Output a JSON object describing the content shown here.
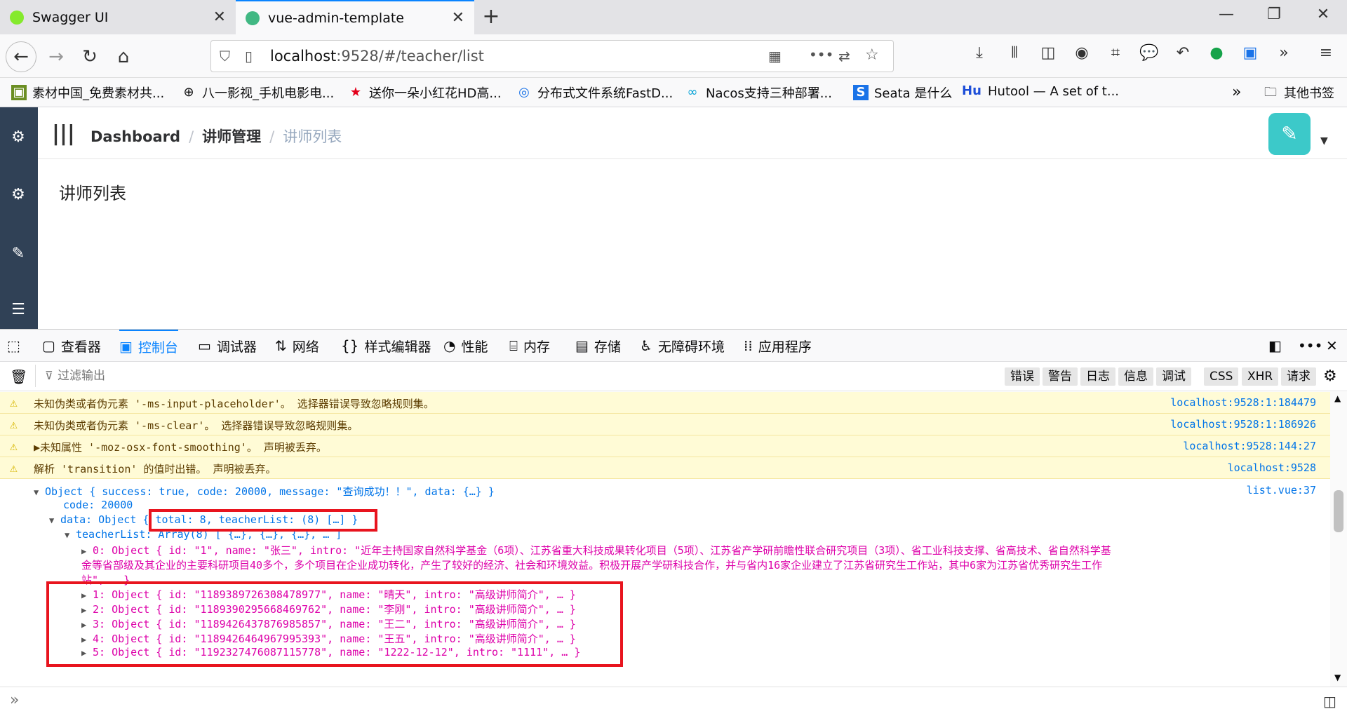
{
  "browser": {
    "tabs": [
      {
        "title": "Swagger UI",
        "color": "#85ea2d"
      },
      {
        "title": "vue-admin-template",
        "color": "#41b883"
      }
    ],
    "url_host": "localhost",
    "url_rest": ":9528/#/teacher/list"
  },
  "bookmarks": [
    {
      "icon": "image-icon",
      "label": "素材中国_免费素材共..."
    },
    {
      "icon": "globe-icon",
      "label": "八一影视_手机电影电..."
    },
    {
      "icon": "star-icon",
      "label": "送你一朵小红花HD高..."
    },
    {
      "icon": "fastdfs-icon",
      "label": "分布式文件系统FastD..."
    },
    {
      "icon": "nacos-icon",
      "label": "Nacos支持三种部署..."
    },
    {
      "icon": "seata-icon",
      "label": "Seata 是什么"
    },
    {
      "icon": "hutool-icon",
      "label": "Hutool — A set of t..."
    }
  ],
  "bookmarks_other": "其他书签",
  "app": {
    "breadcrumb": [
      "Dashboard",
      "讲师管理",
      "讲师列表"
    ],
    "page_title": "讲师列表"
  },
  "devtools": {
    "tabs": [
      "查看器",
      "控制台",
      "调试器",
      "网络",
      "样式编辑器",
      "性能",
      "内存",
      "存储",
      "无障碍环境",
      "应用程序"
    ],
    "active_tab": "控制台",
    "filter_placeholder": "过滤输出",
    "filters": [
      "错误",
      "警告",
      "日志",
      "信息",
      "调试",
      "CSS",
      "XHR",
      "请求"
    ],
    "warnings": [
      {
        "text": "未知伪类或者伪元素 '-ms-input-placeholder'。  选择器错误导致忽略规则集。",
        "loc": "localhost:9528:1:184479"
      },
      {
        "text": "未知伪类或者伪元素 '-ms-clear'。  选择器错误导致忽略规则集。",
        "loc": "localhost:9528:1:186926"
      },
      {
        "text": "▶未知属性 '-moz-osx-font-smoothing'。  声明被丢弃。",
        "loc": "localhost:9528:144:27"
      },
      {
        "text": "解析 'transition' 的值时出错。  声明被丢弃。",
        "loc": "localhost:9528"
      }
    ],
    "log_loc": "list.vue:37",
    "log": {
      "root": "Object { success: true, code: 20000, message: \"查询成功！！\", data: {…} }",
      "code": "code: 20000",
      "data_label": "data: Object ",
      "data_summary": "{ total: 8, teacherList: (8) […] }",
      "teacherList": "teacherList: Array(8) [ {…}, {…}, {…}, … ]",
      "item0_a": "0: Object { id: \"1\", name: \"张三\", intro: \"近年主持国家自然科学基金（6项）、江苏省重大科技成果转化项目（5项）、江苏省产学研前瞻性联合研究项目（3项）、省工业科技支撑、省高技术、省自然科学基",
      "item0_b": "金等省部级及其企业的主要科研项目40多个，多个项目在企业成功转化，产生了较好的经济、社会和环境效益。积极开展产学研科技合作，并与省内16家企业建立了江苏省研究生工作站，其中6家为江苏省优秀研究生工作",
      "item0_c": "站\", … }",
      "items": [
        "1: Object { id: \"1189389726308478977\", name: \"晴天\", intro: \"高级讲师简介\", … }",
        "2: Object { id: \"1189390295668469762\", name: \"李刚\", intro: \"高级讲师简介\", … }",
        "3: Object { id: \"1189426437876985857\", name: \"王二\", intro: \"高级讲师简介\", … }",
        "4: Object { id: \"1189426464967995393\", name: \"王五\", intro: \"高级讲师简介\", … }",
        "5: Object { id: \"1192327476087115778\", name: \"1222-12-12\", intro: \"1111\", … }"
      ]
    },
    "prompt": "»"
  }
}
